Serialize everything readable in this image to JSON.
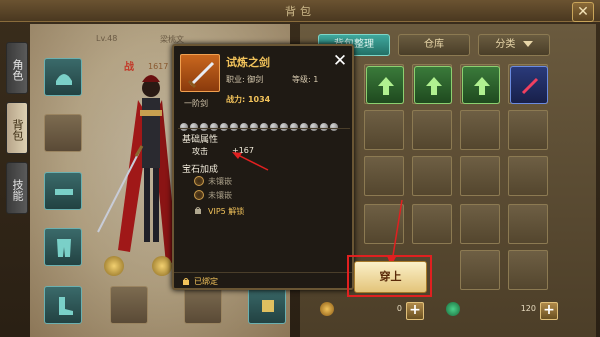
{
  "window": {
    "title": "背包",
    "close_glyph": "✕"
  },
  "side_tabs": [
    {
      "label": "角色",
      "active": false
    },
    {
      "label": "背包",
      "active": true
    },
    {
      "label": "技能",
      "active": false
    }
  ],
  "character": {
    "level": "Lv.48",
    "name": "梁桃文",
    "power_prefix": "战",
    "power_partial": "1617"
  },
  "top_buttons": {
    "sort": "背包整理",
    "warehouse": "仓库",
    "category": "分类"
  },
  "popup": {
    "item_name": "试炼之剑",
    "profession_label": "职业: 御剑",
    "level_label": "等级: 1",
    "rank_label": "一阶剑",
    "power_label": "战力: 1034",
    "base_attr_title": "基础属性",
    "attack_label": "攻击",
    "attack_value": "+167",
    "gem_title": "宝石加成",
    "gem_slot_1": "未镶嵌",
    "gem_slot_2": "未镶嵌",
    "vip_unlock": "VIP5 解锁",
    "bound_label": "已绑定",
    "star_count": 16
  },
  "equip_button": {
    "label": "穿上"
  },
  "currency": {
    "gold_value": "0",
    "jade_value": "120"
  },
  "colors": {
    "highlight_red": "#e02020",
    "title_gold": "#f2c35b",
    "teal_button": "#3fa89e"
  }
}
